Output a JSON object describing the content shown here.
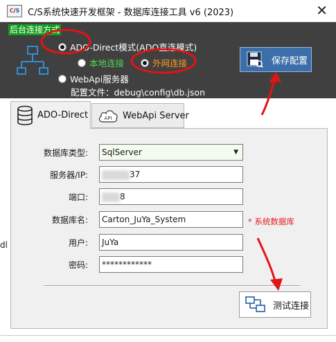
{
  "window": {
    "title": "C/S系统快速开发框架 - 数据库连接工具 v6 (2023)",
    "app_icon_text": [
      "C",
      "S"
    ],
    "close_glyph": "✕"
  },
  "connection": {
    "section_label": "后台连接方式",
    "options": {
      "ado_direct": "ADO-Direct模式(ADO直连模式)",
      "local": "本地连接",
      "external": "外网连接",
      "webapi": "WebApi服务器"
    },
    "selected": "ado_direct",
    "selected_sub": "external",
    "config_file_label": "配置文件：debug\\config\\db.json",
    "save_button": "保存配置"
  },
  "tabs": [
    {
      "label": "ADO-Direct",
      "icon": "database-icon",
      "active": true
    },
    {
      "label": "WebApi Server",
      "icon": "cloud-api-icon",
      "active": false
    }
  ],
  "cloud_icon_text": "API",
  "form": {
    "db_type_label": "数据库类型:",
    "db_type_value": "SqlServer",
    "server_label": "服务器/IP:",
    "server_value_visible": "37",
    "port_label": "端口:",
    "port_value_visible": "8",
    "db_name_label": "数据库名:",
    "db_name_value": "Carton_JuYa_System",
    "db_name_note": "* 系统数据库",
    "user_label": "用户:",
    "user_value": "JuYa",
    "password_label": "密码:",
    "password_value": "************",
    "test_button": "测试连接"
  },
  "edge_fragment": "dl",
  "colors": {
    "top_panel": "#404040",
    "section_label_bg": "#129b1e",
    "save_button_bg": "#3c6fa9",
    "local_text": "#4fd44f",
    "external_text": "#ff9a1f",
    "note_text": "#e02020",
    "annotation": "#e01414"
  }
}
